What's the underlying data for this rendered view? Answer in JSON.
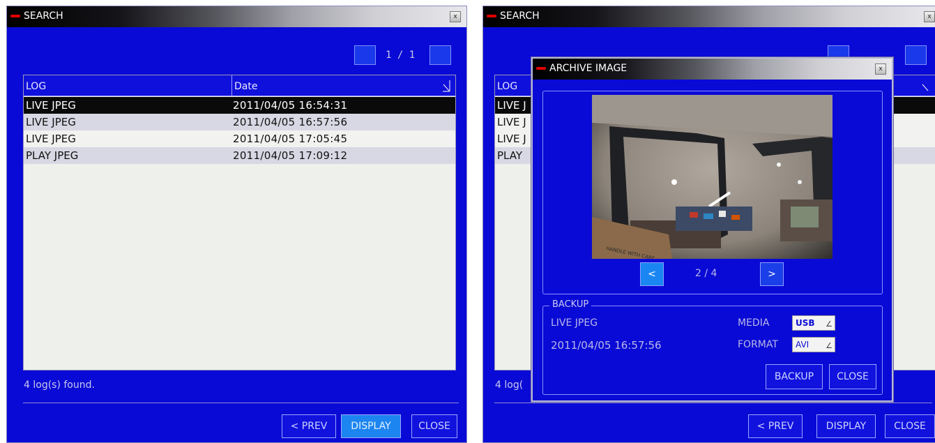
{
  "left_window": {
    "title": "SEARCH",
    "close_glyph": "x",
    "pager": "1 / 1",
    "columns": [
      "LOG",
      "Date"
    ],
    "rows": [
      {
        "log": "LIVE JPEG",
        "date": "2011/04/05 16:54:31",
        "selected": true
      },
      {
        "log": "LIVE JPEG",
        "date": "2011/04/05 16:57:56"
      },
      {
        "log": "LIVE JPEG",
        "date": "2011/04/05 17:05:45"
      },
      {
        "log": "PLAY JPEG",
        "date": "2011/04/05 17:09:12"
      }
    ],
    "status": "4 log(s) found.",
    "buttons": {
      "prev": "< PREV",
      "display": "DISPLAY",
      "close": "CLOSE"
    }
  },
  "right_window": {
    "title": "SEARCH",
    "close_glyph": "x",
    "header_col": "LOG",
    "rows": [
      "LIVE J",
      "LIVE J",
      "LIVE J",
      "PLAY"
    ],
    "status": "4 log(",
    "buttons": {
      "prev": "< PREV",
      "display": "DISPLAY",
      "close": "CLOSE"
    }
  },
  "archive_dialog": {
    "title": "ARCHIVE IMAGE",
    "close_glyph": "x",
    "image_caption": "HANDLE WITH CARE",
    "nav": {
      "prev": "<",
      "next": ">",
      "page": "2 / 4"
    },
    "backup": {
      "group_label": "BACKUP",
      "log_type": "LIVE JPEG",
      "timestamp": "2011/04/05 16:57:56",
      "media_label": "MEDIA",
      "media_value": "USB",
      "format_label": "FORMAT",
      "format_value": "AVI",
      "backup_button": "BACKUP",
      "close_button": "CLOSE"
    }
  },
  "colors": {
    "window_bg": "#0a0ad6",
    "selected_row": "#0a0a0a",
    "active_button": "#1d85f0",
    "title_accent": "#e00000"
  },
  "icons": [
    "close-icon",
    "sort-indicator-icon",
    "dropdown-arrow-icon",
    "prev-arrow-icon",
    "next-arrow-icon"
  ]
}
